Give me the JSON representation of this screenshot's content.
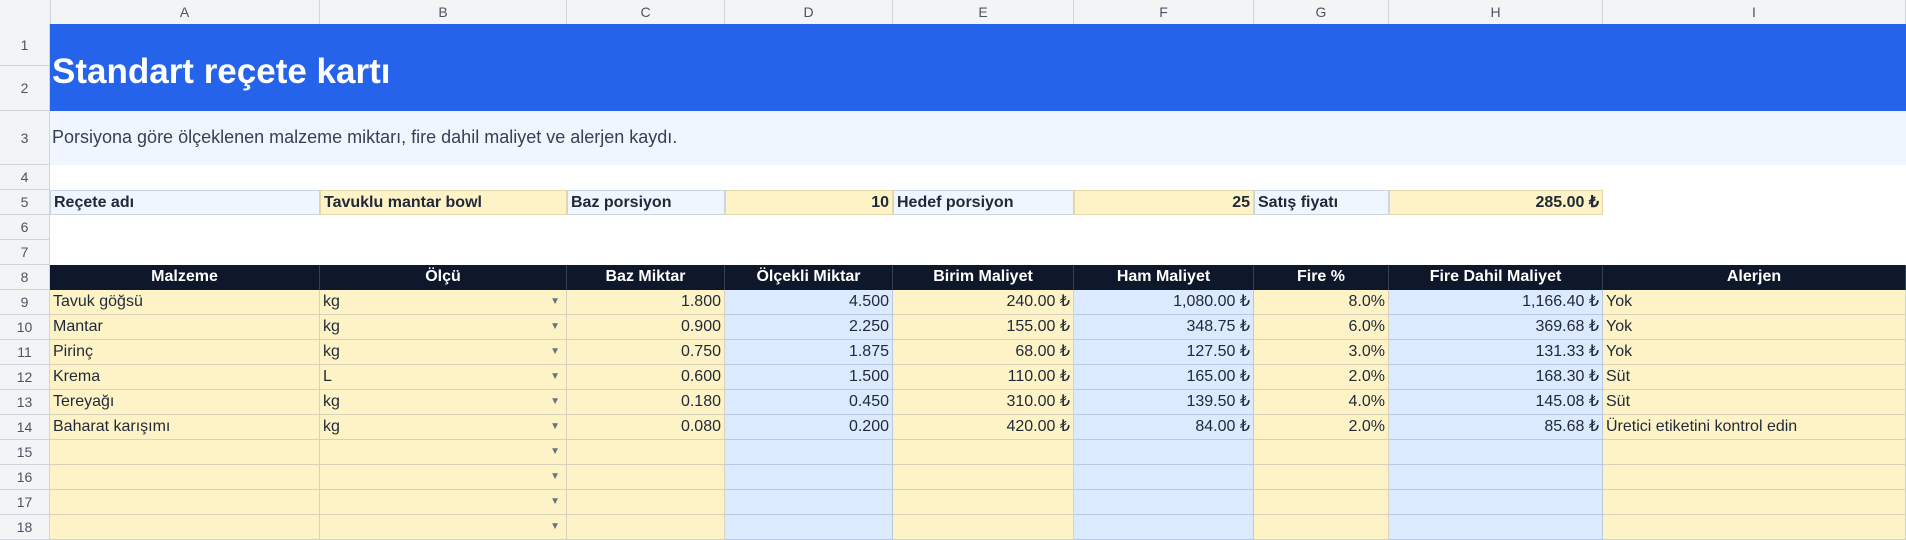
{
  "columns": [
    "A",
    "B",
    "C",
    "D",
    "E",
    "F",
    "G",
    "H",
    "I"
  ],
  "rows": [
    "1",
    "2",
    "3",
    "4",
    "5",
    "6",
    "7",
    "8",
    "9",
    "10",
    "11",
    "12",
    "13",
    "14",
    "15",
    "16",
    "17",
    "18"
  ],
  "title": "Standart reçete kartı",
  "subtitle": "Porsiyona göre ölçeklenen malzeme miktarı, fire dahil maliyet ve alerjen kaydı.",
  "recipe": {
    "name_label": "Reçete adı",
    "name_value": "Tavuklu mantar bowl",
    "base_label": "Baz porsiyon",
    "base_value": "10",
    "target_label": "Hedef porsiyon",
    "target_value": "25",
    "price_label": "Satış fiyatı",
    "price_value": "285.00 ₺"
  },
  "table": {
    "headers": [
      "Malzeme",
      "Ölçü",
      "Baz Miktar",
      "Ölçekli Miktar",
      "Birim Maliyet",
      "Ham Maliyet",
      "Fire %",
      "Fire Dahil Maliyet",
      "Alerjen"
    ],
    "rows": [
      [
        "Tavuk göğsü",
        "kg",
        "1.800",
        "4.500",
        "240.00 ₺",
        "1,080.00 ₺",
        "8.0%",
        "1,166.40 ₺",
        "Yok"
      ],
      [
        "Mantar",
        "kg",
        "0.900",
        "2.250",
        "155.00 ₺",
        "348.75 ₺",
        "6.0%",
        "369.68 ₺",
        "Yok"
      ],
      [
        "Pirinç",
        "kg",
        "0.750",
        "1.875",
        "68.00 ₺",
        "127.50 ₺",
        "3.0%",
        "131.33 ₺",
        "Yok"
      ],
      [
        "Krema",
        "L",
        "0.600",
        "1.500",
        "110.00 ₺",
        "165.00 ₺",
        "2.0%",
        "168.30 ₺",
        "Süt"
      ],
      [
        "Tereyağı",
        "kg",
        "0.180",
        "0.450",
        "310.00 ₺",
        "139.50 ₺",
        "4.0%",
        "145.08 ₺",
        "Süt"
      ],
      [
        "Baharat karışımı",
        "kg",
        "0.080",
        "0.200",
        "420.00 ₺",
        "84.00 ₺",
        "2.0%",
        "85.68 ₺",
        "Üretici etiketini kontrol edin"
      ],
      [
        "",
        "",
        "",
        "",
        "",
        "",
        "",
        "",
        ""
      ],
      [
        "",
        "",
        "",
        "",
        "",
        "",
        "",
        "",
        ""
      ],
      [
        "",
        "",
        "",
        "",
        "",
        "",
        "",
        "",
        ""
      ],
      [
        "",
        "",
        "",
        "",
        "",
        "",
        "",
        "",
        ""
      ]
    ]
  },
  "icons": {
    "dropdown": "dropdown-arrow-icon"
  },
  "colors": {
    "title_band": "#2563eb",
    "header_row": "#0f172a",
    "input_fill": "#fef3c7",
    "calc_fill": "#dbeafe"
  }
}
